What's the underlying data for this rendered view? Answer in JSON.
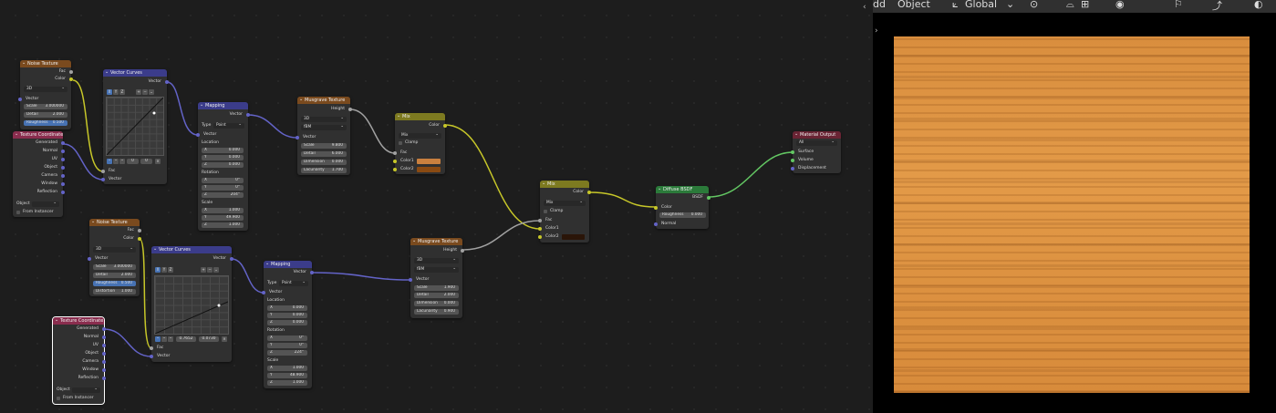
{
  "header": {
    "add_menu": "dd",
    "object_menu": "Object",
    "transform_orientation": "Global"
  },
  "icons": [
    "collapse-arrow-icon",
    "orientation-icon",
    "snap-icon",
    "proportional-icon",
    "overlay-icon",
    "gizmo-icon",
    "shading-icon"
  ],
  "nodes": {
    "noise1": {
      "title": "Noise Texture",
      "out_fac": "Fac",
      "out_color": "Color",
      "dim": "3D",
      "in_vector": "Vector",
      "scale_l": "Scale",
      "scale_v": "3.000000",
      "detail_l": "Detail",
      "detail_v": "2.000",
      "rough_l": "Roughness",
      "rough_v": "0.500"
    },
    "texcoord1": {
      "title": "Texture Coordinate",
      "outs": [
        "Generated",
        "Normal",
        "UV",
        "Object",
        "Camera",
        "Window",
        "Reflection"
      ],
      "object_l": "Object",
      "from_instancer": "From Instancer"
    },
    "curves1": {
      "title": "Vector Curves",
      "out_vector": "Vector",
      "btn_x": "X",
      "btn_y": "Y",
      "btn_z": "Z",
      "v1": "0",
      "v2": "0",
      "in_fac": "Fac",
      "in_vector": "Vector"
    },
    "mapping1": {
      "title": "Mapping",
      "out_vector": "Vector",
      "type_l": "Type",
      "type_v": "Point",
      "in_vector": "Vector",
      "location": "Location",
      "loc_x": "0.000",
      "loc_y": "0.000",
      "loc_z": "0.000",
      "rotation": "Rotation",
      "rot_x": "0°",
      "rot_y": "0°",
      "rot_z": "204°",
      "scale": "Scale",
      "sc_x": "1.000",
      "sc_y": "49.900",
      "sc_z": "1.000"
    },
    "musgrave1": {
      "title": "Musgrave Texture",
      "out_height": "Height",
      "dim": "3D",
      "type": "fBM",
      "in_vector": "Vector",
      "scale_l": "Scale",
      "scale_v": "9.800",
      "detail_l": "Detail",
      "detail_v": "6.000",
      "dimension_l": "Dimension",
      "dimension_v": "0.000",
      "lac_l": "Lacunarity",
      "lac_v": "1.700"
    },
    "mix1": {
      "title": "Mix",
      "out_color": "Color",
      "blend": "Mix",
      "clamp": "Clamp",
      "in_fac": "Fac",
      "in_color1": "Color1",
      "in_color2": "Color2"
    },
    "noise2": {
      "title": "Noise Texture",
      "out_fac": "Fac",
      "out_color": "Color",
      "dim": "3D",
      "in_vector": "Vector",
      "scale_l": "Scale",
      "scale_v": "3.000000",
      "detail_l": "Detail",
      "detail_v": "2.000",
      "rough_l": "Roughness",
      "rough_v": "0.500",
      "dist_l": "Distortion",
      "dist_v": "1.000"
    },
    "curves2": {
      "title": "Vector Curves",
      "out_vector": "Vector",
      "btn_x": "X",
      "btn_y": "Y",
      "btn_z": "Z",
      "v1": "0.7652",
      "v2": "0.0730",
      "in_fac": "Fac",
      "in_vector": "Vector"
    },
    "mapping2": {
      "title": "Mapping",
      "out_vector": "Vector",
      "type_l": "Type",
      "type_v": "Point",
      "in_vector": "Vector",
      "location": "Location",
      "loc_x": "0.000",
      "loc_y": "0.000",
      "loc_z": "0.000",
      "rotation": "Rotation",
      "rot_x": "0°",
      "rot_y": "0°",
      "rot_z": "224°",
      "scale": "Scale",
      "sc_x": "1.000",
      "sc_y": "48.900",
      "sc_z": "1.000"
    },
    "musgrave2": {
      "title": "Musgrave Texture",
      "out_height": "Height",
      "dim": "3D",
      "type": "fBM",
      "in_vector": "Vector",
      "scale_l": "Scale",
      "scale_v": "1.900",
      "detail_l": "Detail",
      "detail_v": "2.000",
      "dimension_l": "Dimension",
      "dimension_v": "0.000",
      "lac_l": "Lacunarity",
      "lac_v": "0.900"
    },
    "texcoord2": {
      "title": "Texture Coordinate",
      "outs": [
        "Generated",
        "Normal",
        "UV",
        "Object",
        "Camera",
        "Window",
        "Reflection"
      ],
      "object_l": "Object",
      "from_instancer": "From Instancer"
    },
    "mix2": {
      "title": "Mix",
      "out_color": "Color",
      "blend": "Mix",
      "clamp": "Clamp",
      "in_fac": "Fac",
      "in_color1": "Color1",
      "in_color2": "Color2"
    },
    "diffuse": {
      "title": "Diffuse BSDF",
      "out_bsdf": "BSDF",
      "in_color": "Color",
      "rough_l": "Roughness",
      "rough_v": "0.000",
      "in_normal": "Normal"
    },
    "output": {
      "title": "Material Output",
      "target": "All",
      "in_surface": "Surface",
      "in_volume": "Volume",
      "in_displacement": "Displacement"
    }
  },
  "colors": {
    "mix1_color1": "#c9803f",
    "mix1_color2": "#8a4a12",
    "mix2_color2": "#2a1508"
  }
}
